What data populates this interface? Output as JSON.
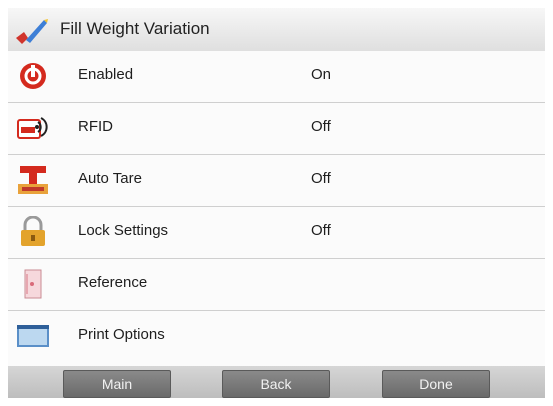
{
  "title": "Fill Weight Variation",
  "items": [
    {
      "label": "Enabled",
      "value": "On",
      "icon": "power-icon"
    },
    {
      "label": "RFID",
      "value": "Off",
      "icon": "rfid-icon"
    },
    {
      "label": "Auto Tare",
      "value": "Off",
      "icon": "auto-tare-icon"
    },
    {
      "label": "Lock Settings",
      "value": "Off",
      "icon": "padlock-icon"
    },
    {
      "label": "Reference",
      "value": "",
      "icon": "reference-document-icon"
    },
    {
      "label": "Print Options",
      "value": "",
      "icon": "printer-monitor-icon"
    }
  ],
  "buttons": {
    "main": "Main",
    "back": "Back",
    "done": "Done"
  },
  "colors": {
    "accent_red": "#d42a1e",
    "button_gray": "#7a7a7a",
    "title_bg": "#e9e9e9"
  }
}
